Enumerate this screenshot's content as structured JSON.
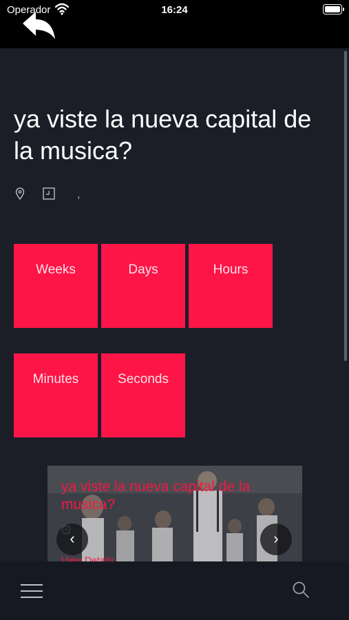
{
  "status_bar": {
    "carrier": "Operador",
    "time": "16:24"
  },
  "event": {
    "title": "ya viste la nueva capital de la musica?",
    "meta_separator": ","
  },
  "countdown": {
    "tiles": [
      {
        "label": "Weeks"
      },
      {
        "label": "Days"
      },
      {
        "label": "Hours"
      },
      {
        "label": "Minutes"
      },
      {
        "label": "Seconds"
      }
    ]
  },
  "featured": {
    "title": "ya viste la nueva capital de la musica?",
    "link": "View Details",
    "prev": "‹",
    "next": "›"
  },
  "colors": {
    "accent": "#fd1548",
    "background": "#1b1e27",
    "bar": "#161922"
  },
  "icons": [
    "back-arrow-icon",
    "location-pin-icon",
    "calendar-clock-icon",
    "menu-icon",
    "search-icon",
    "chevron-left-icon",
    "chevron-right-icon"
  ]
}
